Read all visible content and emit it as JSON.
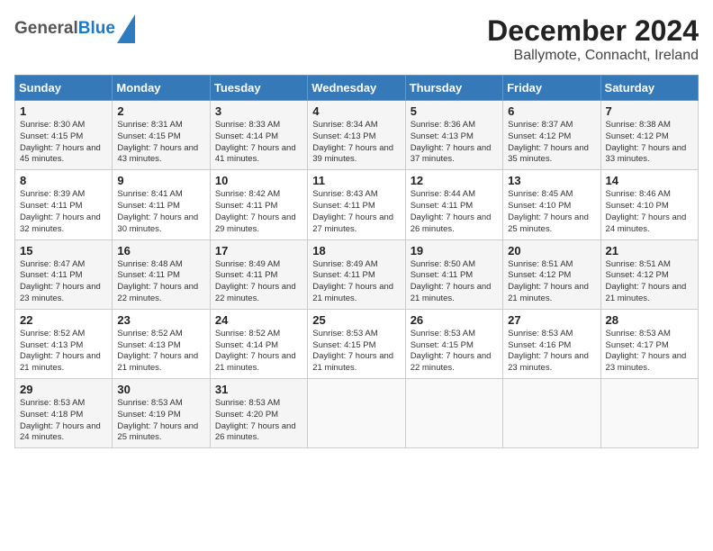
{
  "header": {
    "logo_line1": "General",
    "logo_line2": "Blue",
    "title": "December 2024",
    "subtitle": "Ballymote, Connacht, Ireland"
  },
  "calendar": {
    "days_of_week": [
      "Sunday",
      "Monday",
      "Tuesday",
      "Wednesday",
      "Thursday",
      "Friday",
      "Saturday"
    ],
    "weeks": [
      [
        {
          "day": "1",
          "sunrise": "Sunrise: 8:30 AM",
          "sunset": "Sunset: 4:15 PM",
          "daylight": "Daylight: 7 hours and 45 minutes."
        },
        {
          "day": "2",
          "sunrise": "Sunrise: 8:31 AM",
          "sunset": "Sunset: 4:15 PM",
          "daylight": "Daylight: 7 hours and 43 minutes."
        },
        {
          "day": "3",
          "sunrise": "Sunrise: 8:33 AM",
          "sunset": "Sunset: 4:14 PM",
          "daylight": "Daylight: 7 hours and 41 minutes."
        },
        {
          "day": "4",
          "sunrise": "Sunrise: 8:34 AM",
          "sunset": "Sunset: 4:13 PM",
          "daylight": "Daylight: 7 hours and 39 minutes."
        },
        {
          "day": "5",
          "sunrise": "Sunrise: 8:36 AM",
          "sunset": "Sunset: 4:13 PM",
          "daylight": "Daylight: 7 hours and 37 minutes."
        },
        {
          "day": "6",
          "sunrise": "Sunrise: 8:37 AM",
          "sunset": "Sunset: 4:12 PM",
          "daylight": "Daylight: 7 hours and 35 minutes."
        },
        {
          "day": "7",
          "sunrise": "Sunrise: 8:38 AM",
          "sunset": "Sunset: 4:12 PM",
          "daylight": "Daylight: 7 hours and 33 minutes."
        }
      ],
      [
        {
          "day": "8",
          "sunrise": "Sunrise: 8:39 AM",
          "sunset": "Sunset: 4:11 PM",
          "daylight": "Daylight: 7 hours and 32 minutes."
        },
        {
          "day": "9",
          "sunrise": "Sunrise: 8:41 AM",
          "sunset": "Sunset: 4:11 PM",
          "daylight": "Daylight: 7 hours and 30 minutes."
        },
        {
          "day": "10",
          "sunrise": "Sunrise: 8:42 AM",
          "sunset": "Sunset: 4:11 PM",
          "daylight": "Daylight: 7 hours and 29 minutes."
        },
        {
          "day": "11",
          "sunrise": "Sunrise: 8:43 AM",
          "sunset": "Sunset: 4:11 PM",
          "daylight": "Daylight: 7 hours and 27 minutes."
        },
        {
          "day": "12",
          "sunrise": "Sunrise: 8:44 AM",
          "sunset": "Sunset: 4:11 PM",
          "daylight": "Daylight: 7 hours and 26 minutes."
        },
        {
          "day": "13",
          "sunrise": "Sunrise: 8:45 AM",
          "sunset": "Sunset: 4:10 PM",
          "daylight": "Daylight: 7 hours and 25 minutes."
        },
        {
          "day": "14",
          "sunrise": "Sunrise: 8:46 AM",
          "sunset": "Sunset: 4:10 PM",
          "daylight": "Daylight: 7 hours and 24 minutes."
        }
      ],
      [
        {
          "day": "15",
          "sunrise": "Sunrise: 8:47 AM",
          "sunset": "Sunset: 4:11 PM",
          "daylight": "Daylight: 7 hours and 23 minutes."
        },
        {
          "day": "16",
          "sunrise": "Sunrise: 8:48 AM",
          "sunset": "Sunset: 4:11 PM",
          "daylight": "Daylight: 7 hours and 22 minutes."
        },
        {
          "day": "17",
          "sunrise": "Sunrise: 8:49 AM",
          "sunset": "Sunset: 4:11 PM",
          "daylight": "Daylight: 7 hours and 22 minutes."
        },
        {
          "day": "18",
          "sunrise": "Sunrise: 8:49 AM",
          "sunset": "Sunset: 4:11 PM",
          "daylight": "Daylight: 7 hours and 21 minutes."
        },
        {
          "day": "19",
          "sunrise": "Sunrise: 8:50 AM",
          "sunset": "Sunset: 4:11 PM",
          "daylight": "Daylight: 7 hours and 21 minutes."
        },
        {
          "day": "20",
          "sunrise": "Sunrise: 8:51 AM",
          "sunset": "Sunset: 4:12 PM",
          "daylight": "Daylight: 7 hours and 21 minutes."
        },
        {
          "day": "21",
          "sunrise": "Sunrise: 8:51 AM",
          "sunset": "Sunset: 4:12 PM",
          "daylight": "Daylight: 7 hours and 21 minutes."
        }
      ],
      [
        {
          "day": "22",
          "sunrise": "Sunrise: 8:52 AM",
          "sunset": "Sunset: 4:13 PM",
          "daylight": "Daylight: 7 hours and 21 minutes."
        },
        {
          "day": "23",
          "sunrise": "Sunrise: 8:52 AM",
          "sunset": "Sunset: 4:13 PM",
          "daylight": "Daylight: 7 hours and 21 minutes."
        },
        {
          "day": "24",
          "sunrise": "Sunrise: 8:52 AM",
          "sunset": "Sunset: 4:14 PM",
          "daylight": "Daylight: 7 hours and 21 minutes."
        },
        {
          "day": "25",
          "sunrise": "Sunrise: 8:53 AM",
          "sunset": "Sunset: 4:15 PM",
          "daylight": "Daylight: 7 hours and 21 minutes."
        },
        {
          "day": "26",
          "sunrise": "Sunrise: 8:53 AM",
          "sunset": "Sunset: 4:15 PM",
          "daylight": "Daylight: 7 hours and 22 minutes."
        },
        {
          "day": "27",
          "sunrise": "Sunrise: 8:53 AM",
          "sunset": "Sunset: 4:16 PM",
          "daylight": "Daylight: 7 hours and 23 minutes."
        },
        {
          "day": "28",
          "sunrise": "Sunrise: 8:53 AM",
          "sunset": "Sunset: 4:17 PM",
          "daylight": "Daylight: 7 hours and 23 minutes."
        }
      ],
      [
        {
          "day": "29",
          "sunrise": "Sunrise: 8:53 AM",
          "sunset": "Sunset: 4:18 PM",
          "daylight": "Daylight: 7 hours and 24 minutes."
        },
        {
          "day": "30",
          "sunrise": "Sunrise: 8:53 AM",
          "sunset": "Sunset: 4:19 PM",
          "daylight": "Daylight: 7 hours and 25 minutes."
        },
        {
          "day": "31",
          "sunrise": "Sunrise: 8:53 AM",
          "sunset": "Sunset: 4:20 PM",
          "daylight": "Daylight: 7 hours and 26 minutes."
        },
        null,
        null,
        null,
        null
      ]
    ]
  }
}
